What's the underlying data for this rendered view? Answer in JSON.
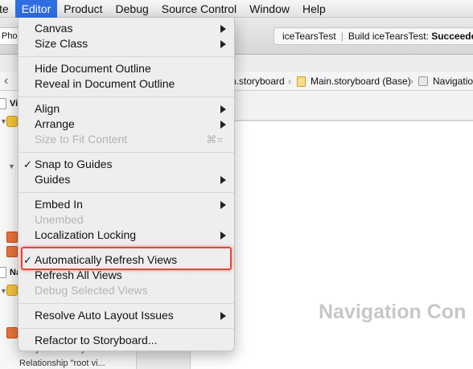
{
  "menubar": {
    "items": [
      {
        "label": "te",
        "active": false
      },
      {
        "label": "Editor",
        "active": true
      },
      {
        "label": "Product",
        "active": false
      },
      {
        "label": "Debug",
        "active": false
      },
      {
        "label": "Source Control",
        "active": false
      },
      {
        "label": "Window",
        "active": false
      },
      {
        "label": "Help",
        "active": false
      }
    ]
  },
  "toolbar": {
    "scheme_label": "Phon",
    "activity_project": "iceTearsTest",
    "activity_status_prefix": "Build iceTearsTest:",
    "activity_status": "Succeeded"
  },
  "jumpbar": {
    "back_icon": "chevron-left-icon",
    "crumb_1": "n.storyboard",
    "crumb_2": "Main.storyboard (Base)",
    "crumb_3": "Navigatio"
  },
  "outline": {
    "row_1": "Vi",
    "row_2": "Na",
    "row_3": "Relationship \"root vi...",
    "row_4": "Storyboard Entry Poi..."
  },
  "canvas": {
    "title": "Navigation Con"
  },
  "editor_menu": {
    "items": {
      "canvas": {
        "label": "Canvas",
        "submenu": true,
        "enabled": true
      },
      "size_class": {
        "label": "Size Class",
        "submenu": true,
        "enabled": true
      },
      "hide_outline": {
        "label": "Hide Document Outline",
        "enabled": true
      },
      "reveal_outline": {
        "label": "Reveal in Document Outline",
        "enabled": true
      },
      "align": {
        "label": "Align",
        "submenu": true,
        "enabled": true
      },
      "arrange": {
        "label": "Arrange",
        "submenu": true,
        "enabled": true
      },
      "size_to_fit": {
        "label": "Size to Fit Content",
        "shortcut": "⌘=",
        "enabled": false
      },
      "snap_to_guides": {
        "label": "Snap to Guides",
        "checked": true,
        "enabled": true
      },
      "guides": {
        "label": "Guides",
        "submenu": true,
        "enabled": true
      },
      "embed_in": {
        "label": "Embed In",
        "submenu": true,
        "enabled": true
      },
      "unembed": {
        "label": "Unembed",
        "enabled": false
      },
      "localization_locking": {
        "label": "Localization Locking",
        "submenu": true,
        "enabled": true
      },
      "auto_refresh": {
        "label": "Automatically Refresh Views",
        "checked": true,
        "enabled": true
      },
      "refresh_all": {
        "label": "Refresh All Views",
        "enabled": true
      },
      "debug_selected": {
        "label": "Debug Selected Views",
        "enabled": false
      },
      "resolve_auto_layout": {
        "label": "Resolve Auto Layout Issues",
        "submenu": true,
        "enabled": true
      },
      "refactor": {
        "label": "Refactor to Storyboard...",
        "enabled": true
      }
    },
    "checkmark": "✓"
  },
  "colors": {
    "menu_highlight": "#2f6ee0",
    "annotation_box": "#e8443a",
    "disabled_text": "#b4b4b4"
  }
}
